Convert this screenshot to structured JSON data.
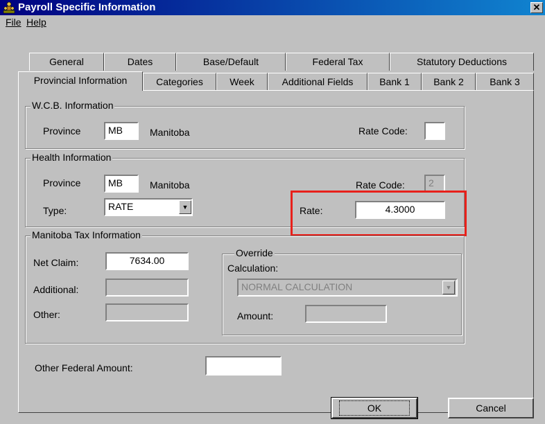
{
  "window": {
    "title": "Payroll Specific Information",
    "close_glyph": "✕"
  },
  "menu": {
    "file": "File",
    "help": "Help"
  },
  "tabs_row1": [
    "General",
    "Dates",
    "Base/Default",
    "Federal Tax",
    "Statutory Deductions"
  ],
  "tabs_row2": [
    "Provincial Information",
    "Categories",
    "Week",
    "Additional Fields",
    "Bank 1",
    "Bank 2",
    "Bank 3"
  ],
  "active_tab": "Provincial Information",
  "wcb": {
    "title": "W.C.B. Information",
    "province_label": "Province",
    "province_code": "MB",
    "province_name": "Manitoba",
    "rate_code_label": "Rate Code:",
    "rate_code_value": ""
  },
  "health": {
    "title": "Health Information",
    "province_label": "Province",
    "province_code": "MB",
    "province_name": "Manitoba",
    "rate_code_label": "Rate Code:",
    "rate_code_value": "2",
    "type_label": "Type:",
    "type_value": "RATE",
    "rate_label": "Rate:",
    "rate_value": "4.3000"
  },
  "tax": {
    "title": "Manitoba  Tax Information",
    "net_claim_label": "Net Claim:",
    "net_claim_value": "7634.00",
    "additional_label": "Additional:",
    "additional_value": "",
    "other_label": "Other:",
    "other_value": "",
    "override": {
      "title": "Override",
      "calculation_label": "Calculation:",
      "calculation_value": "NORMAL CALCULATION",
      "amount_label": "Amount:",
      "amount_value": ""
    }
  },
  "other_federal": {
    "label": "Other Federal Amount:",
    "value": ""
  },
  "buttons": {
    "ok": "OK",
    "cancel": "Cancel"
  },
  "colors": {
    "highlight": "#e8201a",
    "titlebar": "#000080",
    "face": "#c0c0c0"
  },
  "icons": {
    "app": "payroll-people-icon",
    "combo": "dropdown-arrow-icon"
  }
}
